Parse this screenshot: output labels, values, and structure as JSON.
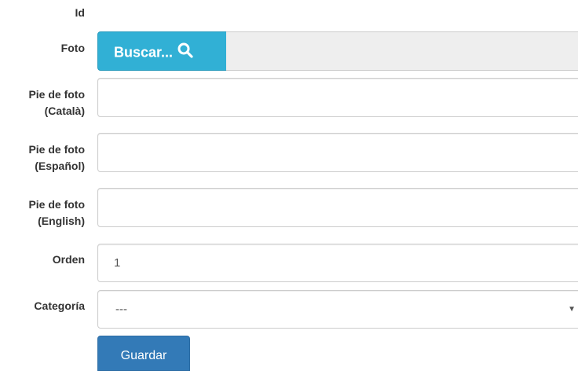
{
  "form": {
    "id_label": "Id",
    "photo_label": "Foto",
    "browse_label": "Buscar...",
    "browse_icon": "search-icon",
    "caption_ca_label_line1": "Pie de foto",
    "caption_ca_label_line2": "(Català)",
    "caption_ca_value": "",
    "caption_es_label_line1": "Pie de foto",
    "caption_es_label_line2": "(Español)",
    "caption_es_value": "",
    "caption_en_label_line1": "Pie de foto",
    "caption_en_label_line2": "(English)",
    "caption_en_value": "",
    "order_label": "Orden",
    "order_value": "1",
    "category_label": "Categoría",
    "category_selected": "---",
    "save_label": "Guardar"
  },
  "colors": {
    "info_button": "#31b0d5",
    "primary_button": "#337ab7",
    "label_text": "#333333"
  }
}
